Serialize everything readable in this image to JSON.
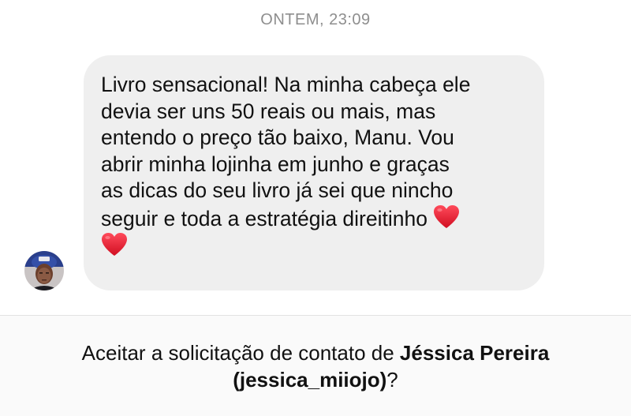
{
  "thread": {
    "timestamp": "ONTEM, 23:09"
  },
  "message": {
    "text": "Livro sensacional! Na minha cabeça ele\ndevia ser uns 50 reais ou mais, mas\nentendo o preço tão baixo, Manu. Vou\nabrir minha lojinha em junho e graças\nas dicas do seu livro já sei que nincho\nseguir e toda a estratégia direitinho",
    "emoji_icon": "red-heart-icon",
    "emoji_count": 2
  },
  "sender": {
    "avatar_icon": "profile-photo"
  },
  "request": {
    "prefix": "Aceitar a solicitação de contato de ",
    "name": "Jéssica Pereira",
    "handle": "(jessica_miiojo)",
    "suffix": "?"
  },
  "colors": {
    "bubble": "#efefef",
    "timestamp": "#8e8e8e",
    "heart": "#e8172c"
  }
}
